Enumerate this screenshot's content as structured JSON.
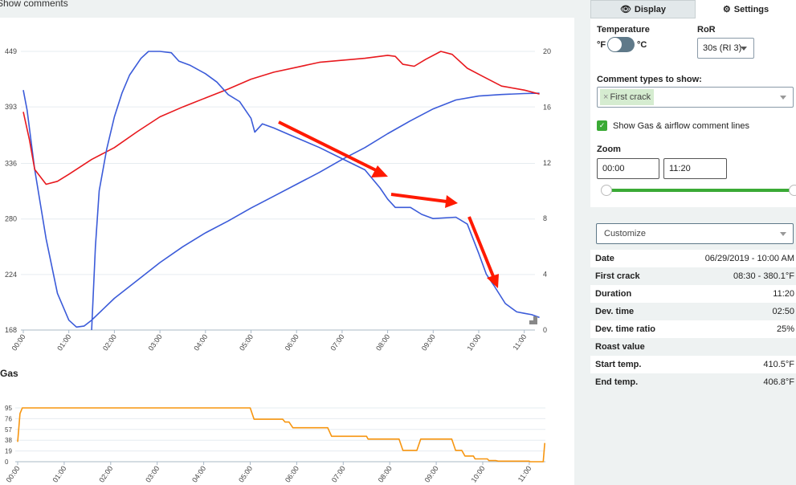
{
  "topbar": {
    "show_comments": "Show comments"
  },
  "chart_data": [
    {
      "type": "line",
      "title": "",
      "xlabel": "",
      "ylabel": "",
      "x_unit": "mm:ss",
      "xticks": [
        "00:00",
        "01:00",
        "02:00",
        "03:00",
        "04:00",
        "05:00",
        "06:00",
        "07:00",
        "08:00",
        "09:00",
        "10:00",
        "11:00"
      ],
      "xlim": [
        "00:00",
        "11:20"
      ],
      "yticks_left": [
        449,
        393,
        336,
        280,
        224,
        168
      ],
      "ylim_left": [
        168,
        449
      ],
      "yticks_right": [
        20,
        16,
        12,
        8,
        4,
        0
      ],
      "ylim_right": [
        0,
        20
      ],
      "grid": true,
      "series": [
        {
          "color": "#3b5bd9",
          "axis": "left",
          "points": [
            [
              "00:00",
              410
            ],
            [
              "00:05",
              390
            ],
            [
              "00:15",
              330
            ],
            [
              "00:30",
              260
            ],
            [
              "00:45",
              205
            ],
            [
              "01:00",
              178
            ],
            [
              "01:10",
              171
            ],
            [
              "01:20",
              172
            ],
            [
              "01:30",
              178
            ],
            [
              "02:00",
              200
            ],
            [
              "02:30",
              218
            ],
            [
              "03:00",
              236
            ],
            [
              "03:30",
              252
            ],
            [
              "04:00",
              266
            ],
            [
              "04:30",
              278
            ],
            [
              "05:00",
              291
            ],
            [
              "05:30",
              303
            ],
            [
              "06:00",
              315
            ],
            [
              "06:30",
              327
            ],
            [
              "07:00",
              340
            ],
            [
              "07:30",
              352
            ],
            [
              "08:00",
              366
            ],
            [
              "08:30",
              379
            ],
            [
              "09:00",
              391
            ],
            [
              "09:30",
              400
            ],
            [
              "10:00",
              404
            ],
            [
              "10:30",
              405.5
            ],
            [
              "11:00",
              406.5
            ],
            [
              "11:20",
              406.8
            ]
          ]
        },
        {
          "color": "#e8191e",
          "axis": "left",
          "points": [
            [
              "00:00",
              388
            ],
            [
              "00:08",
              360
            ],
            [
              "00:15",
              330
            ],
            [
              "00:30",
              315
            ],
            [
              "00:45",
              318
            ],
            [
              "01:00",
              325
            ],
            [
              "01:30",
              340
            ],
            [
              "02:00",
              352
            ],
            [
              "02:30",
              368
            ],
            [
              "03:00",
              383
            ],
            [
              "03:30",
              393
            ],
            [
              "04:00",
              402
            ],
            [
              "04:30",
              411
            ],
            [
              "05:00",
              421
            ],
            [
              "05:30",
              428
            ],
            [
              "06:00",
              433
            ],
            [
              "06:30",
              438
            ],
            [
              "07:00",
              440
            ],
            [
              "07:30",
              442
            ],
            [
              "08:00",
              445
            ],
            [
              "08:10",
              444
            ],
            [
              "08:20",
              436
            ],
            [
              "08:35",
              434
            ],
            [
              "08:50",
              441
            ],
            [
              "09:10",
              449
            ],
            [
              "09:25",
              446
            ],
            [
              "09:45",
              432
            ],
            [
              "10:05",
              424
            ],
            [
              "10:30",
              414
            ],
            [
              "11:00",
              410
            ],
            [
              "11:20",
              406
            ]
          ]
        },
        {
          "color": "#3b5bd9",
          "axis": "right",
          "points": [
            [
              "01:30",
              0
            ],
            [
              "01:35",
              6
            ],
            [
              "01:40",
              10
            ],
            [
              "01:50",
              13
            ],
            [
              "02:00",
              15.3
            ],
            [
              "02:10",
              17
            ],
            [
              "02:20",
              18.3
            ],
            [
              "02:35",
              19.5
            ],
            [
              "02:45",
              20
            ],
            [
              "03:00",
              20
            ],
            [
              "03:15",
              19.9
            ],
            [
              "03:25",
              19.3
            ],
            [
              "03:40",
              19
            ],
            [
              "04:00",
              18.4
            ],
            [
              "04:15",
              17.8
            ],
            [
              "04:30",
              16.9
            ],
            [
              "04:45",
              16.4
            ],
            [
              "05:00",
              15.2
            ],
            [
              "05:05",
              14.2
            ],
            [
              "05:15",
              14.8
            ],
            [
              "05:30",
              14.5
            ],
            [
              "06:00",
              13.8
            ],
            [
              "06:30",
              13.1
            ],
            [
              "07:00",
              12.3
            ],
            [
              "07:30",
              11.5
            ],
            [
              "07:50",
              10.2
            ],
            [
              "08:00",
              9.4
            ],
            [
              "08:10",
              8.8
            ],
            [
              "08:30",
              8.8
            ],
            [
              "08:45",
              8.3
            ],
            [
              "09:00",
              8.0
            ],
            [
              "09:30",
              8.1
            ],
            [
              "09:45",
              7.6
            ],
            [
              "10:00",
              5.5
            ],
            [
              "10:10",
              4.0
            ],
            [
              "10:20",
              3.2
            ],
            [
              "10:35",
              1.9
            ],
            [
              "10:50",
              1.3
            ],
            [
              "11:00",
              1.2
            ],
            [
              "11:10",
              1.1
            ],
            [
              "11:20",
              0.9
            ]
          ]
        }
      ]
    },
    {
      "type": "line",
      "title": "Gas",
      "xlabel": "",
      "ylabel": "",
      "xticks": [
        "00:00",
        "01:00",
        "02:00",
        "03:00",
        "04:00",
        "05:00",
        "06:00",
        "07:00",
        "08:00",
        "09:00",
        "10:00",
        "11:00"
      ],
      "xlim": [
        "00:00",
        "11:20"
      ],
      "yticks": [
        95,
        76,
        57,
        38,
        19,
        0
      ],
      "ylim": [
        0,
        95
      ],
      "grid": true,
      "series": [
        {
          "color": "#f7950f",
          "points": [
            [
              "00:00",
              35
            ],
            [
              "00:03",
              85
            ],
            [
              "00:06",
              95
            ],
            [
              "05:00",
              95
            ],
            [
              "05:05",
              75
            ],
            [
              "05:42",
              75
            ],
            [
              "05:45",
              70
            ],
            [
              "05:50",
              70
            ],
            [
              "05:55",
              60
            ],
            [
              "06:40",
              60
            ],
            [
              "06:45",
              45
            ],
            [
              "07:30",
              45
            ],
            [
              "07:32",
              40
            ],
            [
              "08:12",
              40
            ],
            [
              "08:17",
              20
            ],
            [
              "08:35",
              20
            ],
            [
              "08:40",
              40
            ],
            [
              "09:20",
              40
            ],
            [
              "09:25",
              20
            ],
            [
              "09:33",
              20
            ],
            [
              "09:37",
              10
            ],
            [
              "09:48",
              10
            ],
            [
              "09:50",
              5
            ],
            [
              "10:06",
              5
            ],
            [
              "10:08",
              2
            ],
            [
              "10:17",
              2
            ],
            [
              "10:20",
              1
            ],
            [
              "11:00",
              1
            ],
            [
              "11:01",
              0
            ],
            [
              "11:18",
              0
            ],
            [
              "11:20",
              33
            ]
          ]
        }
      ]
    }
  ],
  "tabs": {
    "display": "Display",
    "settings": "Settings",
    "display_icon": "eye-icon",
    "settings_icon": "gear-icon"
  },
  "settings": {
    "temperature_label": "Temperature",
    "unit_f": "°F",
    "unit_c": "°C",
    "toggle_celsius": false,
    "ror_label": "RoR",
    "ror_value": "30s (RI 3)",
    "comment_types_label": "Comment types to show:",
    "comment_tag": "First crack",
    "comment_tag_remove": "×",
    "show_gas_label": "Show Gas & airflow comment lines",
    "show_gas_checked": true,
    "zoom_label": "Zoom",
    "zoom_start": "00:00",
    "zoom_end": "11:20",
    "zoom_range_percent": [
      0,
      100
    ]
  },
  "customize": {
    "value": "Customize"
  },
  "details": [
    {
      "label": "Date",
      "value": "06/29/2019 - 10:00 AM"
    },
    {
      "label": "First crack",
      "value": "08:30 - 380.1°F"
    },
    {
      "label": "Duration",
      "value": "11:20"
    },
    {
      "label": "Dev. time",
      "value": "02:50"
    },
    {
      "label": "Dev. time ratio",
      "value": "25%"
    },
    {
      "label": "Roast value",
      "value": ""
    },
    {
      "label": "Start temp.",
      "value": "410.5°F"
    },
    {
      "label": "End temp.",
      "value": "406.8°F"
    }
  ],
  "colors": {
    "accent_green": "#3aaa35",
    "tag_bg": "#d5ecd0",
    "bt": "#3b5bd9",
    "et": "#e8191e",
    "gas": "#f7950f",
    "annotation": "#ff1a00"
  }
}
